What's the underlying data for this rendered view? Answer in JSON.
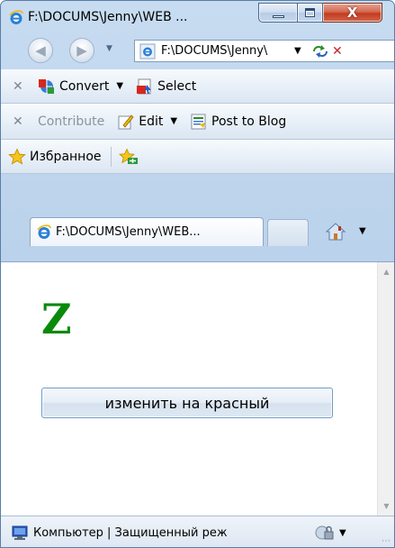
{
  "window": {
    "title": "F:\\DOCUMS\\Jenny\\WEB ...",
    "close_glyph": "X"
  },
  "nav": {
    "address": "F:\\DOCUMS\\Jenny\\",
    "address_placeholder": ""
  },
  "toolbar1": {
    "convert_label": "Convert",
    "select_label": "Select"
  },
  "toolbar2": {
    "contribute_label": "Contribute",
    "edit_label": "Edit",
    "post_label": "Post to Blog"
  },
  "toolbar3": {
    "favorites_label": "Избранное"
  },
  "tabs": [
    {
      "label": "F:\\DOCUMS\\Jenny\\WEB..."
    }
  ],
  "page": {
    "heading": "Z",
    "button_label": "изменить на красный",
    "heading_color": "#0a8a0a"
  },
  "status": {
    "zone_text": "Компьютер | Защищенный реж"
  },
  "icons": {
    "browser": "ie-icon",
    "back": "back-arrow-icon",
    "forward": "forward-arrow-icon",
    "refresh": "refresh-icon",
    "stop": "stop-icon",
    "convert": "pdf-convert-icon",
    "select": "pdf-select-icon",
    "edit": "edit-icon",
    "post": "blog-post-icon",
    "favorites": "favorites-star-icon",
    "add_favorites": "add-favorites-icon",
    "home": "home-icon",
    "computer": "computer-zone-icon",
    "security": "security-icon"
  }
}
